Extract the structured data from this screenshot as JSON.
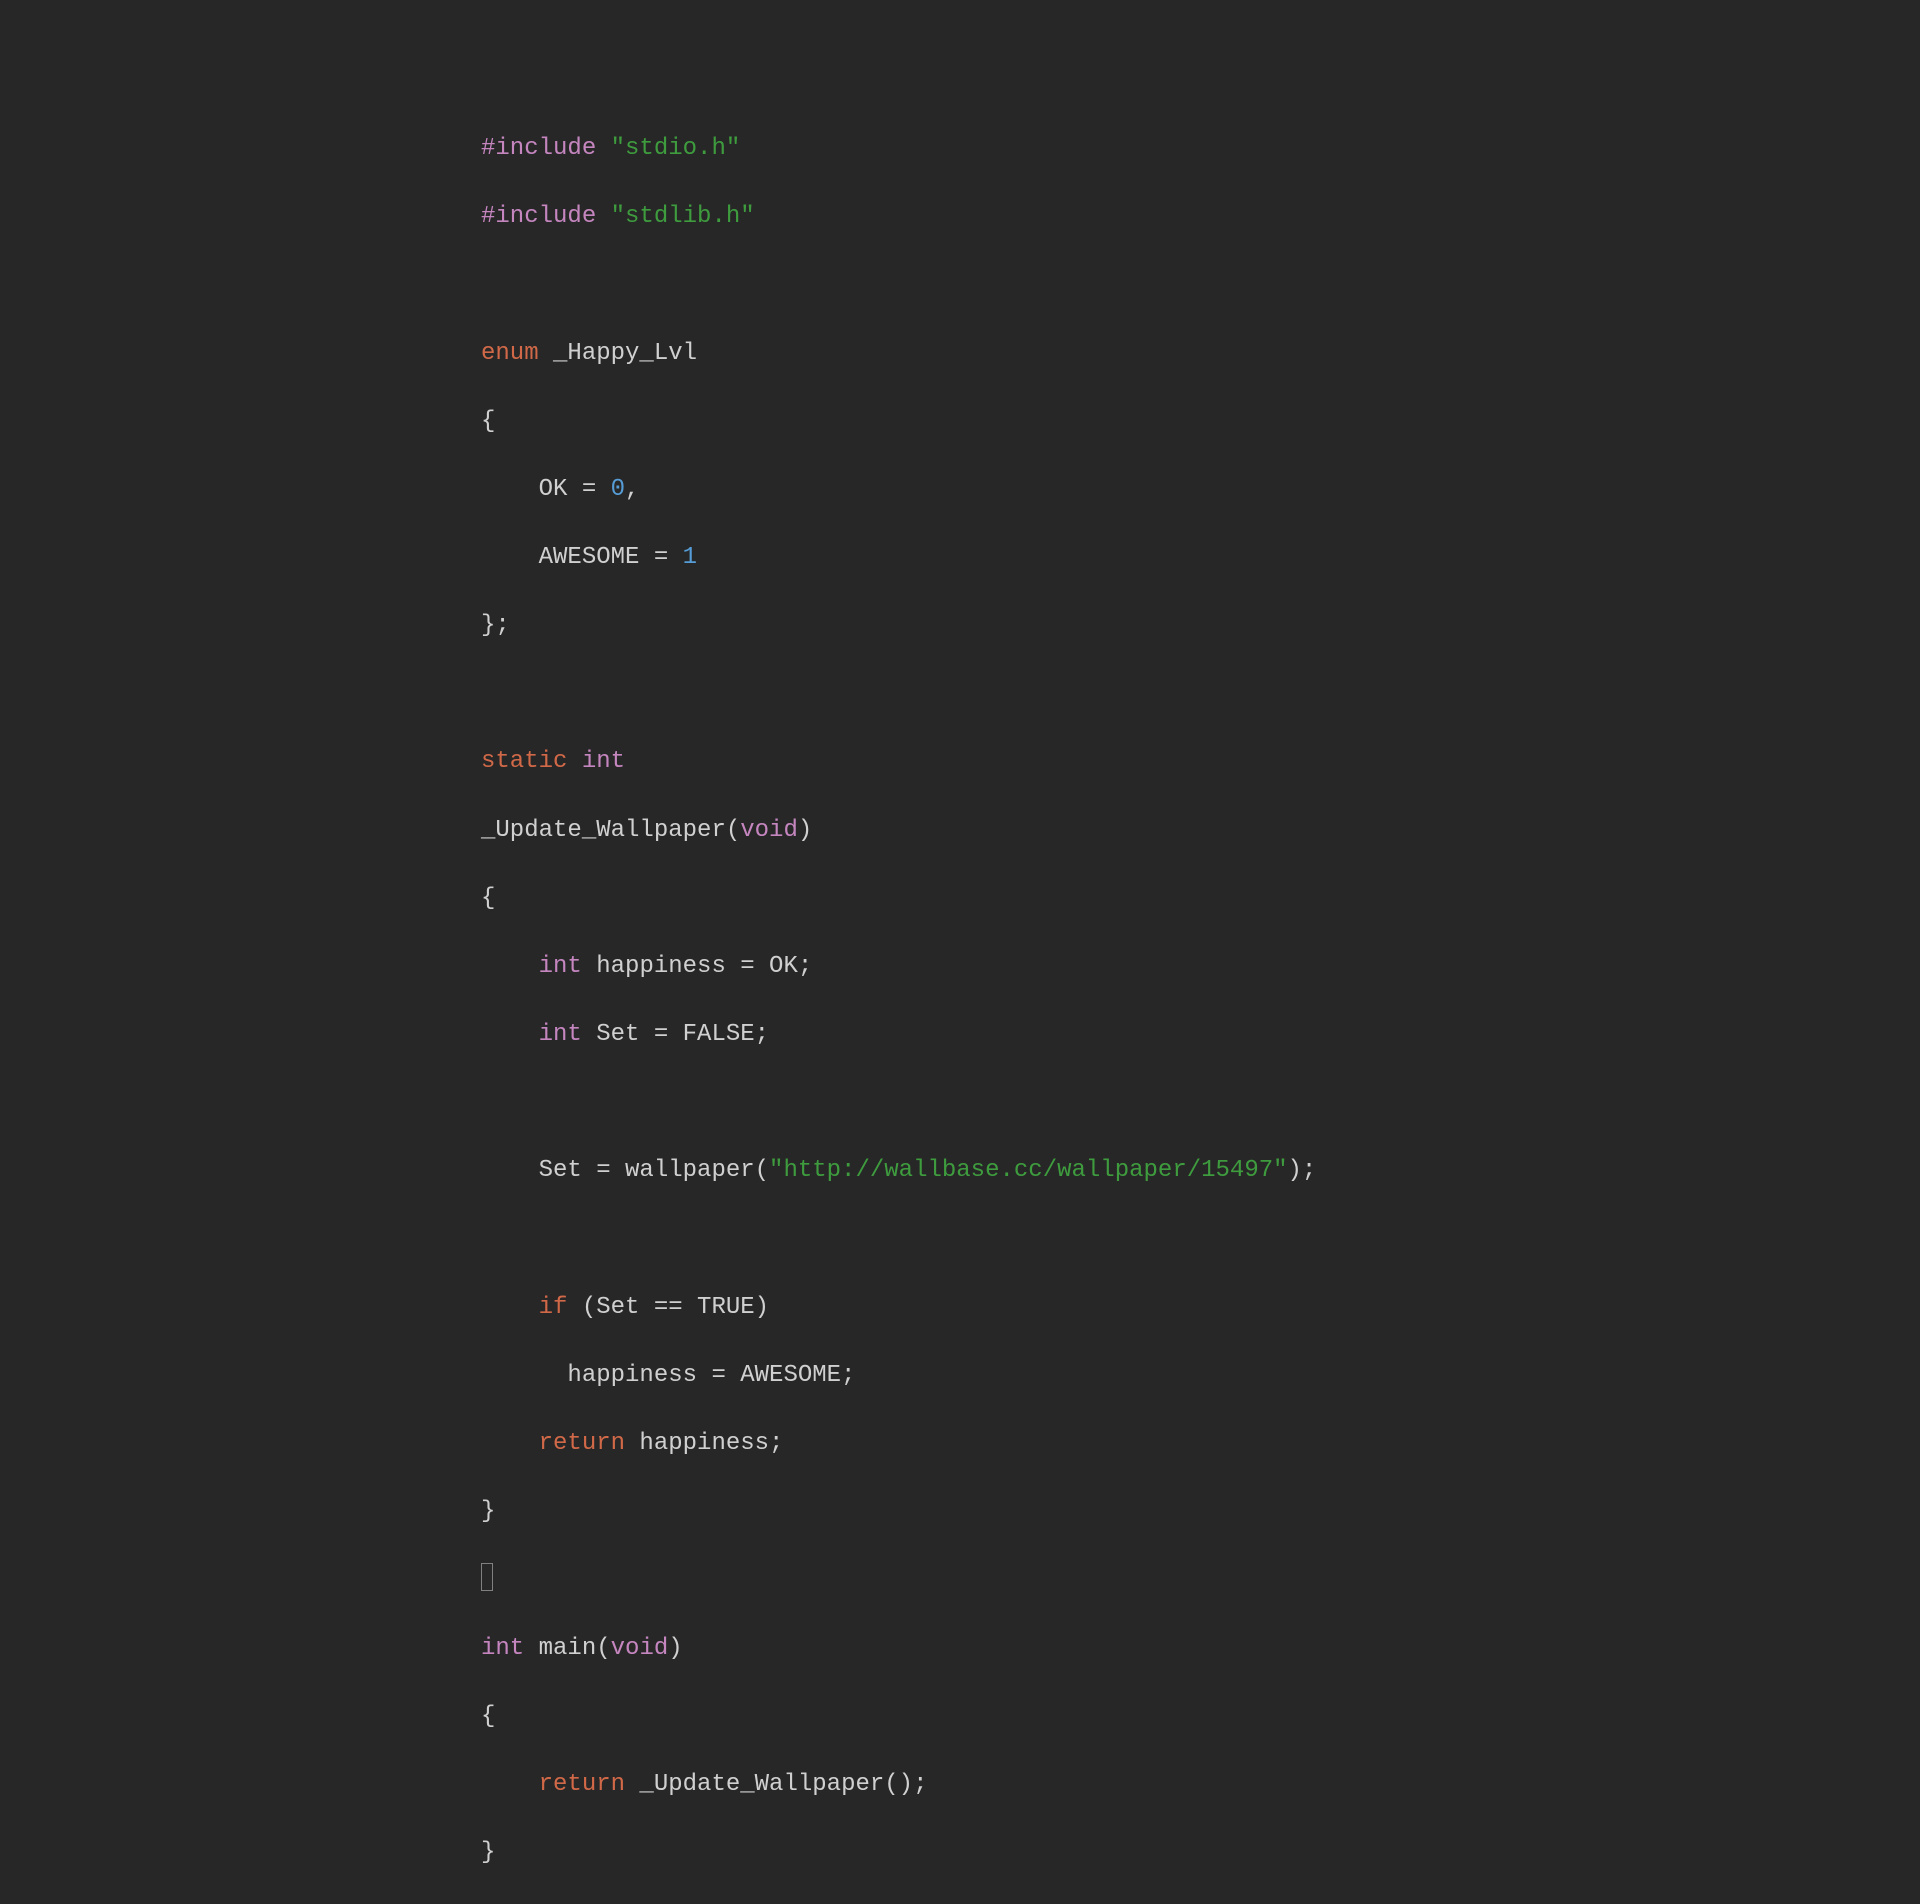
{
  "code": {
    "line1_directive": "#include",
    "line1_string": "\"stdio.h\"",
    "line2_directive": "#include",
    "line2_string": "\"stdlib.h\"",
    "line4_enum": "enum",
    "line4_name": " _Happy_Lvl",
    "line5": "{",
    "line6_pre": "    OK = ",
    "line6_num": "0",
    "line6_post": ",",
    "line7_pre": "    AWESOME = ",
    "line7_num": "1",
    "line8": "};",
    "line10_static": "static",
    "line10_int": " int",
    "line11_pre": "_Update_Wallpaper(",
    "line11_void": "void",
    "line11_post": ")",
    "line12": "{",
    "line13_int": "int",
    "line13_post": " happiness = OK;",
    "line14_int": "int",
    "line14_post": " Set = FALSE;",
    "line16_pre": "    Set = wallpaper(",
    "line16_str": "\"http://wallbase.cc/wallpaper/15497\"",
    "line16_post": ");",
    "line18_indent": "    ",
    "line18_if": "if",
    "line18_post": " (Set == TRUE)",
    "line19": "      happiness = AWESOME;",
    "line20_indent": "    ",
    "line20_return": "return",
    "line20_post": " happiness;",
    "line21": "}",
    "line23_int": "int",
    "line23_main": " main(",
    "line23_void": "void",
    "line23_post": ")",
    "line24": "{",
    "line25_indent": "    ",
    "line25_return": "return",
    "line25_post": " _Update_Wallpaper();",
    "line26": "}"
  }
}
